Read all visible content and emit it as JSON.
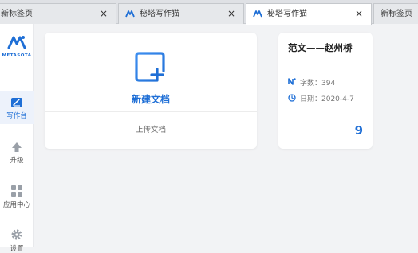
{
  "tabs": [
    {
      "title": "新标签页",
      "close": "×"
    },
    {
      "title": "秘塔写作猫",
      "close": "×"
    },
    {
      "title": "秘塔写作猫",
      "close": "×"
    },
    {
      "title": "新标签页"
    }
  ],
  "brand": {
    "name": "METASOTA"
  },
  "sidebar": {
    "items": [
      {
        "label": "写作台",
        "icon": "edit-icon"
      },
      {
        "label": "升级",
        "icon": "upgrade-arrow-icon"
      },
      {
        "label": "应用中心",
        "icon": "apps-grid-icon"
      },
      {
        "label": "设置",
        "icon": "gear-icon"
      }
    ]
  },
  "main": {
    "new_doc": {
      "label": "新建文档",
      "upload_label": "上传文档"
    },
    "documents": [
      {
        "title": "范文——赵州桥",
        "word_count": "字数：394",
        "date": "日期：2020-4-7",
        "count": "9"
      }
    ]
  },
  "colors": {
    "accent": "#1f6fd6",
    "background": "#f2f3f5"
  }
}
